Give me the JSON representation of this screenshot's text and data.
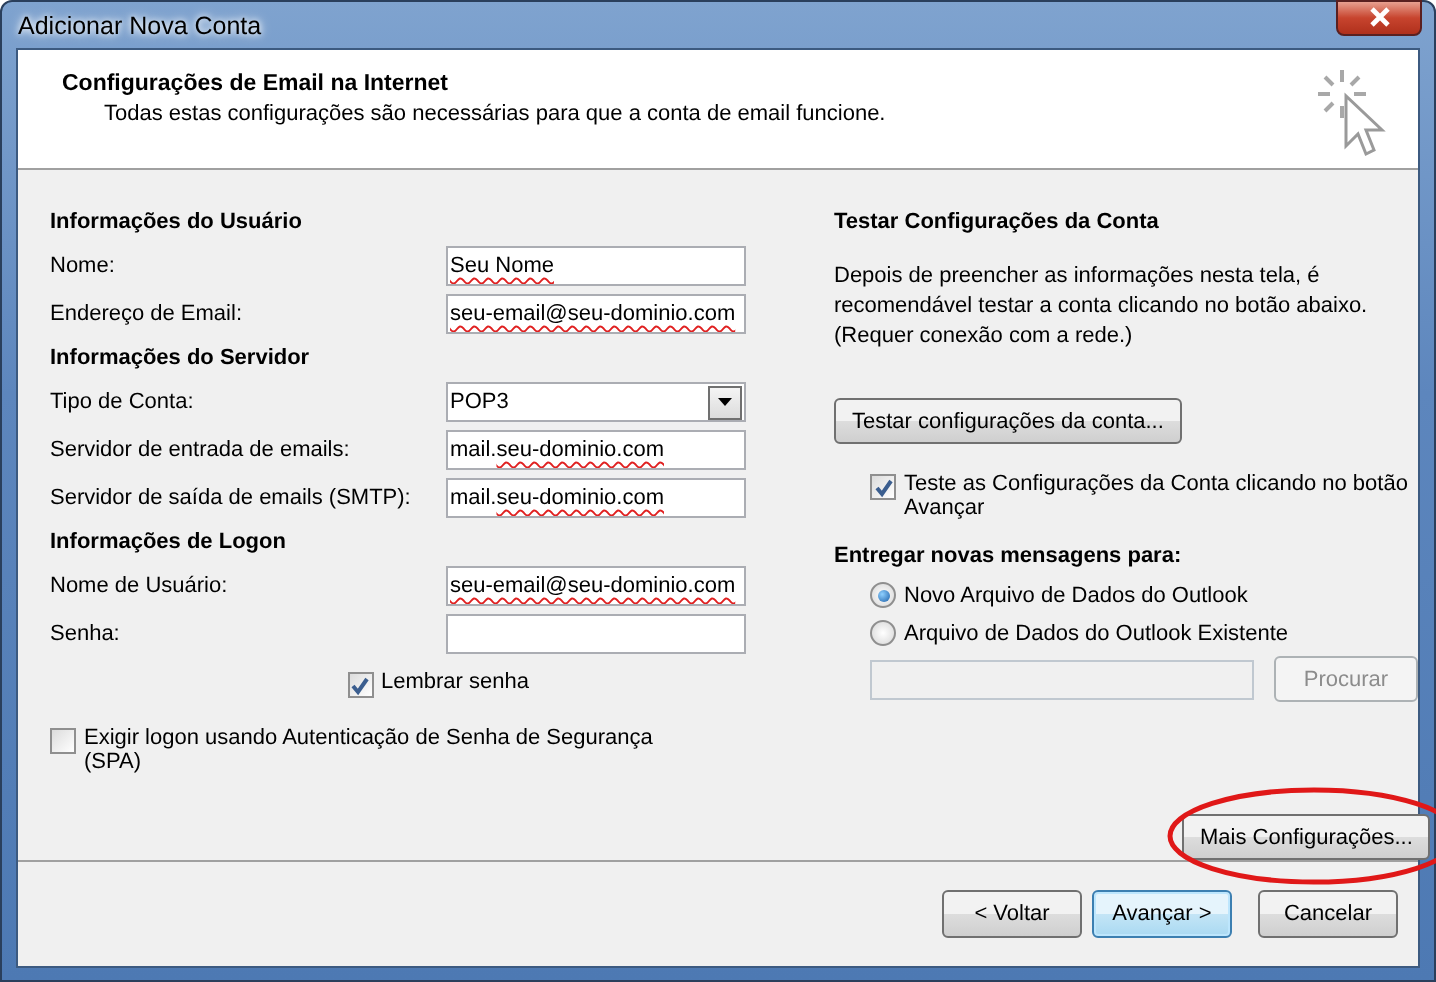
{
  "window": {
    "title": "Adicionar Nova Conta"
  },
  "header": {
    "title": "Configurações de Email na Internet",
    "subtitle": "Todas estas configurações são necessárias para que a conta de email funcione."
  },
  "sections": [
    {
      "heading": "Informações do Usuário",
      "rows": [
        {
          "label": "Nome:",
          "kind": "text",
          "value": [
            {
              "text": "Seu Nome",
              "misspelled": true
            }
          ]
        },
        {
          "label": "Endereço de Email:",
          "kind": "text",
          "value": [
            {
              "text": "seu-email@seu-dominio.com",
              "misspelled": true
            }
          ]
        }
      ]
    },
    {
      "heading": "Informações do Servidor",
      "rows": [
        {
          "label": "Tipo de Conta:",
          "kind": "dropdown",
          "value": [
            {
              "text": "POP3",
              "misspelled": false
            }
          ]
        },
        {
          "label": "Servidor de entrada de emails:",
          "kind": "text",
          "value": [
            {
              "text": "mail.",
              "misspelled": false
            },
            {
              "text": "seu-dominio.com",
              "misspelled": true
            }
          ]
        },
        {
          "label": "Servidor de saída de emails (SMTP):",
          "kind": "text",
          "value": [
            {
              "text": "mail.",
              "misspelled": false
            },
            {
              "text": "seu-dominio.com",
              "misspelled": true
            }
          ]
        }
      ]
    },
    {
      "heading": "Informações de Logon",
      "rows": [
        {
          "label": "Nome de Usuário:",
          "kind": "text",
          "value": [
            {
              "text": "seu-email@seu-dominio.com",
              "misspelled": true
            }
          ]
        },
        {
          "label": "Senha:",
          "kind": "password"
        }
      ]
    }
  ],
  "remember_password": {
    "label": "Lembrar senha",
    "checked": true
  },
  "spa": {
    "label": "Exigir logon usando Autenticação de Senha de Segurança (SPA)",
    "checked": false
  },
  "test": {
    "heading": "Testar Configurações da Conta",
    "description": "Depois de preencher as informações nesta tela, é recomendável testar a conta clicando no botão abaixo.\n(Requer conexão com a rede.)",
    "button": "Testar configurações da conta...",
    "test_on_next": {
      "label": "Teste as Configurações da Conta clicando no botão Avançar",
      "checked": true
    }
  },
  "deliver": {
    "heading": "Entregar novas mensagens para:",
    "options": [
      {
        "label": "Novo Arquivo de Dados do Outlook",
        "selected": true
      },
      {
        "label": "Arquivo de Dados do Outlook Existente",
        "selected": false
      }
    ],
    "path_field": {
      "disabled": true
    },
    "browse_button": {
      "label": "Procurar",
      "disabled": true
    }
  },
  "more_settings": {
    "label": "Mais Configurações...",
    "circled": true
  },
  "buttons": [
    {
      "label": "< Voltar",
      "default": false
    },
    {
      "label": "Avançar >",
      "default": true
    },
    {
      "label": "Cancelar",
      "default": false
    }
  ]
}
